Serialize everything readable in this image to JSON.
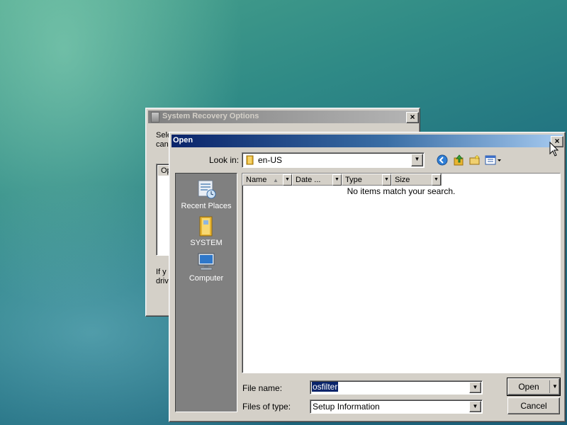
{
  "back_window": {
    "title": "System Recovery Options",
    "text_top_1": "Sele",
    "text_top_2": "can",
    "list_header_fragment": "Op",
    "text_bottom_1": "If y",
    "text_bottom_2": "driv",
    "close_label": "×"
  },
  "open_dialog": {
    "title": "Open",
    "close_label": "×",
    "look_in_label": "Look in:",
    "look_in_value": "en-US",
    "places": [
      {
        "label": "Recent Places",
        "icon": "recent-places-icon"
      },
      {
        "label": "SYSTEM",
        "icon": "folder-icon"
      },
      {
        "label": "Computer",
        "icon": "computer-icon"
      }
    ],
    "columns": [
      {
        "label": "Name"
      },
      {
        "label": "Date ..."
      },
      {
        "label": "Type"
      },
      {
        "label": "Size"
      }
    ],
    "empty_message": "No items match your search.",
    "file_name_label": "File name:",
    "file_name_value": "osfilter",
    "files_of_type_label": "Files of type:",
    "files_of_type_value": "Setup Information",
    "open_button": "Open",
    "cancel_button": "Cancel"
  },
  "colors": {
    "title_active_start": "#0a246a",
    "title_active_end": "#a6caf0",
    "places_bar": "#808080",
    "face": "#d4d0c8"
  }
}
